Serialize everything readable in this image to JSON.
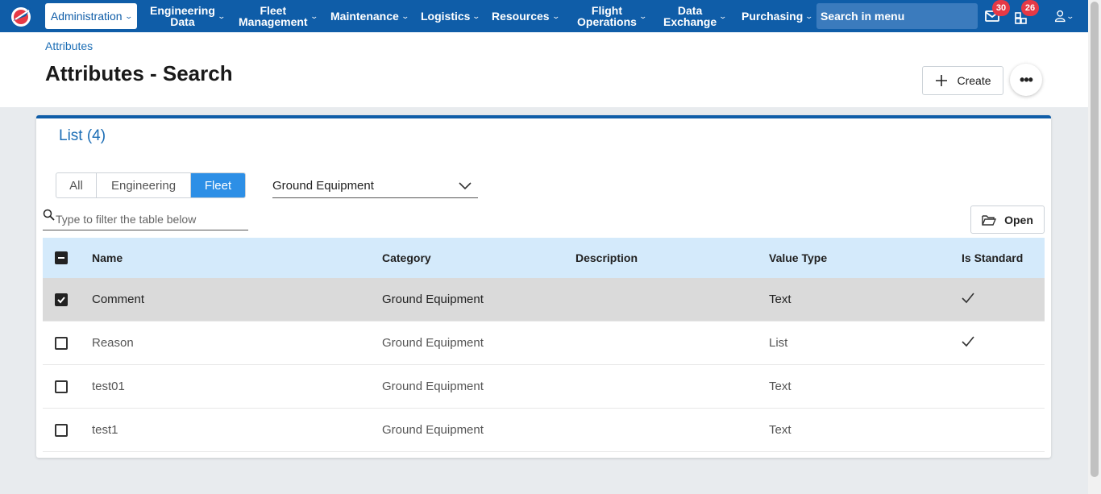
{
  "nav": {
    "admin_label": "Administration",
    "items": [
      {
        "label": "Engineering\nData"
      },
      {
        "label": "Fleet\nManagement"
      },
      {
        "label": "Maintenance"
      },
      {
        "label": "Logistics"
      },
      {
        "label": "Resources"
      },
      {
        "label": "Flight\nOperations"
      },
      {
        "label": "Data\nExchange"
      },
      {
        "label": "Purchasing"
      }
    ],
    "search_placeholder": "Search in menu",
    "mail_badge": "30",
    "apps_badge": "26",
    "colors": {
      "bar": "#0f5da8",
      "badge": "#e63946"
    }
  },
  "header": {
    "breadcrumb": "Attributes",
    "title": "Attributes - Search",
    "create_label": "Create",
    "more_label": "•••"
  },
  "list": {
    "title": "List (4)",
    "segments": [
      {
        "label": "All",
        "active": false
      },
      {
        "label": "Engineering",
        "active": false
      },
      {
        "label": "Fleet",
        "active": true
      }
    ],
    "category_select": "Ground Equipment",
    "filter_placeholder": "Type to filter the table below",
    "open_label": "Open"
  },
  "table": {
    "columns": [
      "Name",
      "Category",
      "Description",
      "Value Type",
      "Is Standard"
    ],
    "rows": [
      {
        "checked": true,
        "selected": true,
        "name": "Comment",
        "category": "Ground Equipment",
        "description": "",
        "value_type": "Text",
        "is_standard": true
      },
      {
        "checked": false,
        "selected": false,
        "name": "Reason",
        "category": "Ground Equipment",
        "description": "",
        "value_type": "List",
        "is_standard": true
      },
      {
        "checked": false,
        "selected": false,
        "name": "test01",
        "category": "Ground Equipment",
        "description": "",
        "value_type": "Text",
        "is_standard": false
      },
      {
        "checked": false,
        "selected": false,
        "name": "test1",
        "category": "Ground Equipment",
        "description": "",
        "value_type": "Text",
        "is_standard": false
      }
    ]
  }
}
